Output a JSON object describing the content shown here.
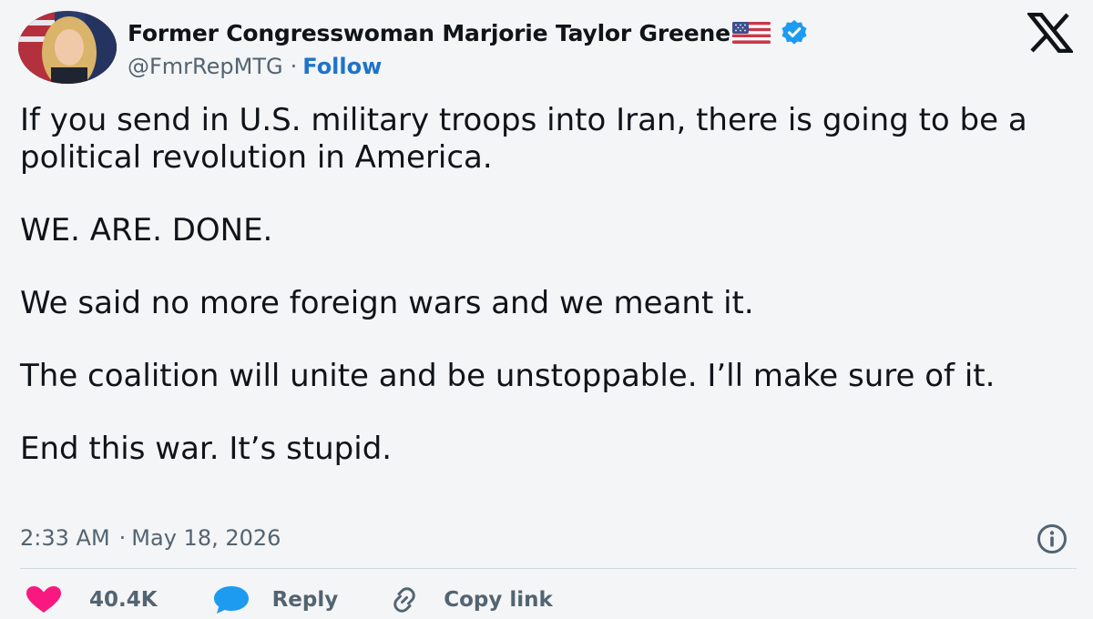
{
  "author": {
    "display_name": "Former Congresswoman Marjorie Taylor Greene",
    "flag_icon": "us-flag-icon",
    "verified_icon": "verified-badge-icon",
    "handle": "@FmrRepMTG",
    "separator": "·",
    "follow_label": "Follow"
  },
  "brand": {
    "logo_icon": "x-logo-icon"
  },
  "tweet": {
    "paragraphs": [
      "If you send in U.S. military troops into Iran, there is going to be a political revolution in America.",
      "WE. ARE. DONE.",
      "We said no more foreign wars and we meant it.",
      "The coalition will unite and be unstoppable. I’ll make sure of it.",
      "End this war. It’s stupid."
    ],
    "time": "2:33 AM",
    "date_separator": "·",
    "date": "May 18, 2026"
  },
  "actions": {
    "like_count": "40.4K",
    "reply_label": "Reply",
    "copy_link_label": "Copy link"
  },
  "colors": {
    "background": "#f4f5f7",
    "text": "#0f1419",
    "muted": "#536471",
    "accent": "#1d74c9",
    "like": "#f91880",
    "reply": "#1d9bf0",
    "verified": "#1d9bf0"
  }
}
